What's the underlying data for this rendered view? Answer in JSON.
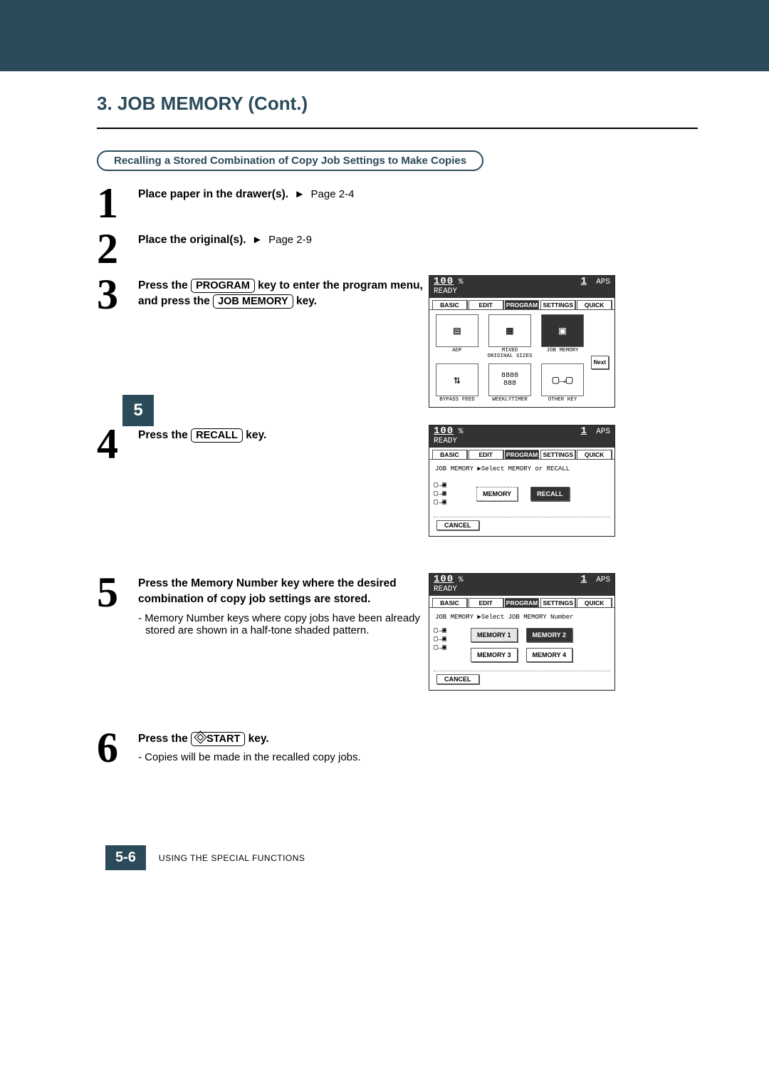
{
  "section_title": "3. JOB MEMORY (Cont.)",
  "subtitle": "Recalling a Stored Combination of Copy Job Settings to Make Copies",
  "left_tab": "5",
  "steps": {
    "s1": {
      "num": "1",
      "bold": "Place paper in the drawer(s).",
      "ref": "Page 2-4"
    },
    "s2": {
      "num": "2",
      "bold": "Place the original(s).",
      "ref": "Page 2-9"
    },
    "s3": {
      "num": "3",
      "pre": "Press the ",
      "key1": "PROGRAM",
      "mid": " key to enter the program menu, and press the ",
      "key2": "JOB MEMORY",
      "post": " key."
    },
    "s4": {
      "num": "4",
      "pre": "Press the ",
      "key": "RECALL",
      "post": " key."
    },
    "s5": {
      "num": "5",
      "bold": "Press the Memory Number key where the desired combination of copy job settings are stored.",
      "note": "Memory Number keys where copy jobs have been already stored are shown in a half-tone shaded pattern."
    },
    "s6": {
      "num": "6",
      "pre": "Press the ",
      "key_icon": "START",
      "post": " key.",
      "note": "Copies will be made in the recalled copy jobs."
    }
  },
  "screens": {
    "common": {
      "zoom": "100",
      "pct": "%",
      "count": "1",
      "aps": "APS",
      "ready": "READY",
      "tabs": {
        "basic": "BASIC",
        "edit": "EDIT",
        "program": "PROGRAM",
        "settings": "SETTINGS",
        "quick": "QUICK"
      }
    },
    "s3": {
      "icons": {
        "adf": "ADF",
        "mixed": "MIXED\nORIGINAL SIZES",
        "jobmem": "JOB MEMORY",
        "bypass": "BYPASS FEED",
        "weekly": "WEEKLYTIMER",
        "other": "OTHER KEY"
      },
      "next": "Next"
    },
    "s4": {
      "msg_pre": "JOB MEMORY  ▶",
      "msg": "Select MEMORY or RECALL",
      "memory": "MEMORY",
      "recall": "RECALL",
      "cancel": "CANCEL"
    },
    "s5": {
      "msg_pre": "JOB MEMORY  ▶",
      "msg": "Select JOB MEMORY Number",
      "m1": "MEMORY 1",
      "m2": "MEMORY 2",
      "m3": "MEMORY 3",
      "m4": "MEMORY 4",
      "cancel": "CANCEL"
    }
  },
  "footer": {
    "page": "5-6",
    "text": "USING THE SPECIAL FUNCTIONS"
  }
}
